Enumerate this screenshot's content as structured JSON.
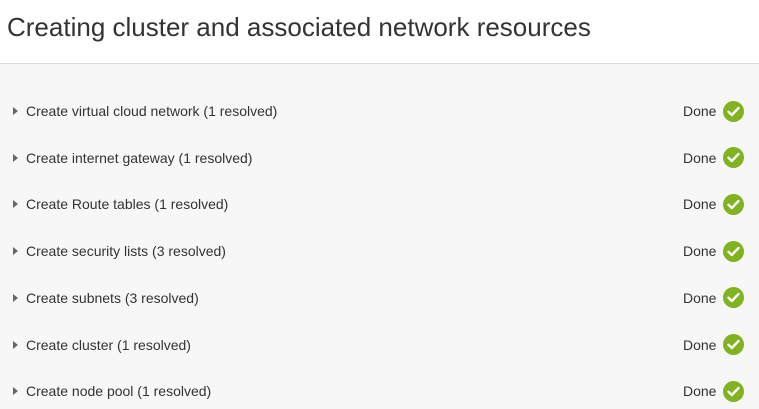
{
  "header": {
    "title": "Creating cluster and associated network resources"
  },
  "colors": {
    "success": "#7fb31f",
    "background": "#f7f7f7",
    "header_background": "#ffffff"
  },
  "steps": [
    {
      "label": "Create virtual cloud network (1 resolved)",
      "status": "Done",
      "icon": "check-circle-icon"
    },
    {
      "label": "Create internet gateway (1 resolved)",
      "status": "Done",
      "icon": "check-circle-icon"
    },
    {
      "label": "Create Route tables (1 resolved)",
      "status": "Done",
      "icon": "check-circle-icon"
    },
    {
      "label": "Create security lists (3 resolved)",
      "status": "Done",
      "icon": "check-circle-icon"
    },
    {
      "label": "Create subnets (3 resolved)",
      "status": "Done",
      "icon": "check-circle-icon"
    },
    {
      "label": "Create cluster (1 resolved)",
      "status": "Done",
      "icon": "check-circle-icon"
    },
    {
      "label": "Create node pool (1 resolved)",
      "status": "Done",
      "icon": "check-circle-icon"
    }
  ]
}
